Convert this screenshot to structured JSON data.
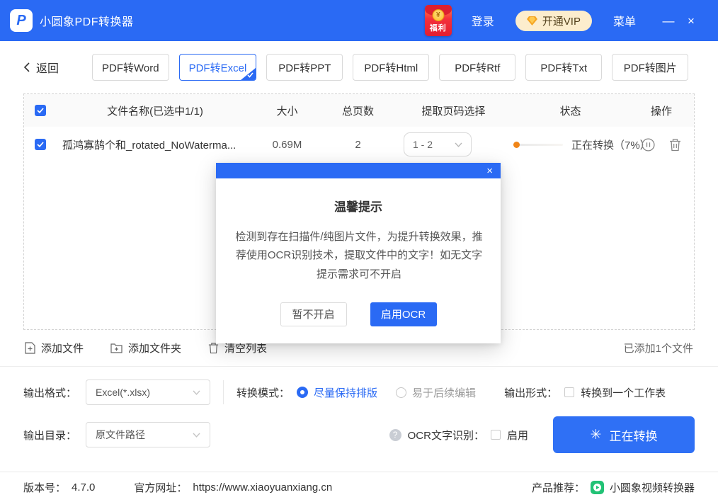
{
  "header": {
    "app_title": "小圆象PDF转换器",
    "logo_glyph": "P",
    "welfare": {
      "label": "福利",
      "coin": "¥"
    },
    "login": "登录",
    "vip": "开通VIP",
    "menu": "菜单",
    "minimize": "—",
    "close": "×"
  },
  "tabbar": {
    "back": "返回",
    "items": [
      {
        "label": "PDF转Word",
        "active": false
      },
      {
        "label": "PDF转Excel",
        "active": true
      },
      {
        "label": "PDF转PPT",
        "active": false
      },
      {
        "label": "PDF转Html",
        "active": false
      },
      {
        "label": "PDF转Rtf",
        "active": false
      },
      {
        "label": "PDF转Txt",
        "active": false
      },
      {
        "label": "PDF转图片",
        "active": false
      }
    ]
  },
  "table": {
    "headers": {
      "name": "文件名称(已选中1/1)",
      "size": "大小",
      "pages": "总页数",
      "page_select": "提取页码选择",
      "status": "状态",
      "action": "操作"
    },
    "rows": [
      {
        "name": "孤鸿寡鹄个和_rotated_NoWaterma...",
        "size": "0.69M",
        "pages": "2",
        "page_range": "1 - 2",
        "progress_percent": 7,
        "status": "正在转换（7%）"
      }
    ]
  },
  "dialog": {
    "title": "温馨提示",
    "body": "检测到存在扫描件/纯图片文件，为提升转换效果，推荐使用OCR识别技术，提取文件中的文字！如无文字提示需求可不开启",
    "cancel": "暂不开启",
    "confirm": "启用OCR",
    "close": "×"
  },
  "toolbar": {
    "add_file": "添加文件",
    "add_folder": "添加文件夹",
    "clear_list": "清空列表",
    "added_count": "已添加1个文件"
  },
  "settings": {
    "output_format_label": "输出格式：",
    "output_format_value": "Excel(*.xlsx)",
    "convert_mode_label": "转换模式：",
    "mode_keep_layout": "尽量保持排版",
    "mode_easy_edit": "易于后续编辑",
    "output_form_label": "输出形式：",
    "one_worksheet": "转换到一个工作表",
    "output_dir_label": "输出目录：",
    "output_dir_value": "原文件路径",
    "ocr_help": "?",
    "ocr_label": "OCR文字识别：",
    "ocr_enable": "启用",
    "convert_button": "正在转换",
    "spinner_glyph": "✳"
  },
  "footer": {
    "version_label": "版本号：",
    "version": "4.7.0",
    "website_label": "官方网址：",
    "website": "https://www.xiaoyuanxiang.cn",
    "recommend_label": "产品推荐：",
    "recommend_product": "小圆象视频转换器"
  },
  "colors": {
    "brand_blue": "#2a6af4",
    "progress_orange": "#f08519",
    "vip_pill_bg": "#fcedcd",
    "envelope_red": "#e31e31",
    "video_green": "#21c275"
  }
}
